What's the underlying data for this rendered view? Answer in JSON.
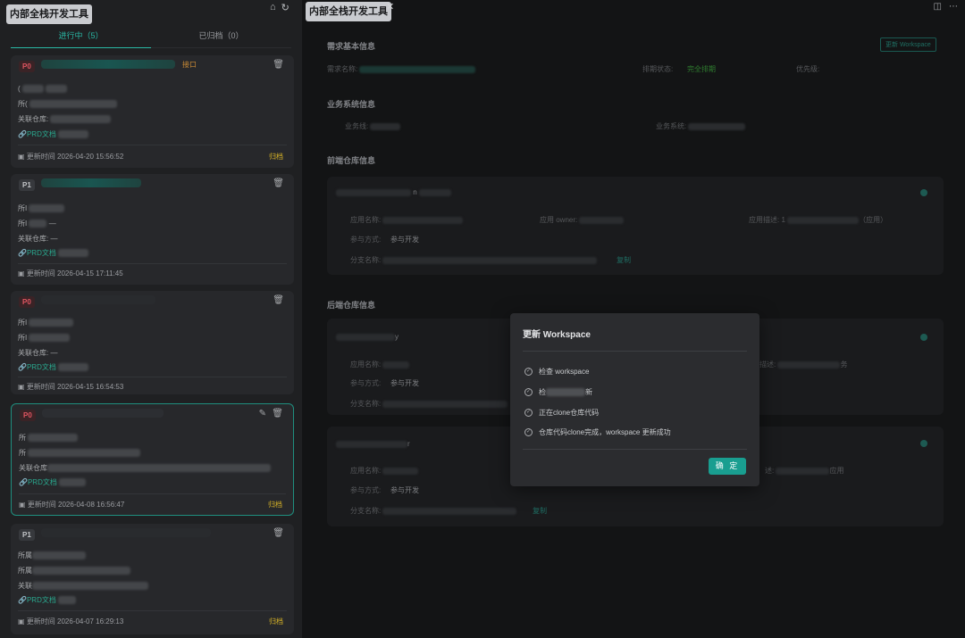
{
  "app": {
    "title": "内部全栈开发工具",
    "main_tab_title": "内部全栈开发工具"
  },
  "left": {
    "tabs": [
      {
        "label": "进行中（5）"
      },
      {
        "label": "已归档（0）"
      }
    ],
    "cards": [
      {
        "priority": "P0",
        "title_suffix": "接口",
        "labels": [
          "(",
          "所(",
          "关联仓库: "
        ],
        "prd_label": "PRD文档",
        "updated": "更新时间 2026-04-20 15:56:52",
        "action": "归档"
      },
      {
        "priority": "P1",
        "title_suffix": "",
        "labels": [
          "所I",
          "所I",
          "关联仓库: —"
        ],
        "prd_label": "PRD文档",
        "updated": "更新时间 2026-04-15 17:11:45",
        "action": ""
      },
      {
        "priority": "P0",
        "title_suffix": "",
        "labels": [
          "所I",
          "所I",
          "关联仓库: —"
        ],
        "prd_label": "PRD文档",
        "updated": "更新时间 2026-04-15 16:54:53",
        "action": ""
      },
      {
        "priority": "P0",
        "title_suffix": "",
        "labels": [
          "所",
          "所",
          "关联仓库"
        ],
        "prd_label": "PRD文档",
        "updated": "更新时间 2026-04-08 16:56:47",
        "action": "归档"
      },
      {
        "priority": "P1",
        "title_suffix": "",
        "labels": [
          "所属",
          "所属",
          "关联"
        ],
        "prd_label": "PRD文档",
        "updated": "更新时间 2026-04-07 16:29:13",
        "action": "归档"
      }
    ]
  },
  "main": {
    "sections": {
      "basic": "需求基本信息",
      "business": "业务系统信息",
      "frontend": "前端仓库信息",
      "backend": "后端仓库信息"
    },
    "update_ws_button": "更新 Workspace",
    "basic": {
      "name_label": "需求名称:",
      "status_label": "排期状态:",
      "status_value": "完全排期",
      "priority_label": "优先级:"
    },
    "business": {
      "line_label": "业务线:",
      "system_label": "业务系统:"
    },
    "frontend_repo": {
      "name_suffix": "n",
      "app_name_label": "应用名称:",
      "owner_label": "应用 owner:",
      "desc_label": "应用描述:",
      "desc_value": "（应用）",
      "participation_label": "参与方式:",
      "participation_value": "参与开发",
      "branch_label": "分支名称:",
      "copy_label": "复制"
    },
    "backend_repo_1": {
      "name_suffix": "y",
      "app_name_label": "应用名称:",
      "desc_label": "描述:",
      "desc_suffix": "务",
      "participation_label": "参与方式:",
      "participation_value": "参与开发",
      "branch_label": "分支名称:"
    },
    "backend_repo_2": {
      "name_suffix": "r",
      "app_name_label": "应用名称:",
      "desc_label": "述:",
      "desc_suffix": "应用",
      "participation_label": "参与方式:",
      "participation_value": "参与开发",
      "branch_label": "分支名称:",
      "copy_label": "复制"
    }
  },
  "modal": {
    "title": "更新 Workspace",
    "steps": [
      "检查 workspace",
      "检",
      "正在clone仓库代码",
      "仓库代码clone完成，workspace 更新成功"
    ],
    "step2_suffix": "新",
    "confirm": "确 定"
  }
}
